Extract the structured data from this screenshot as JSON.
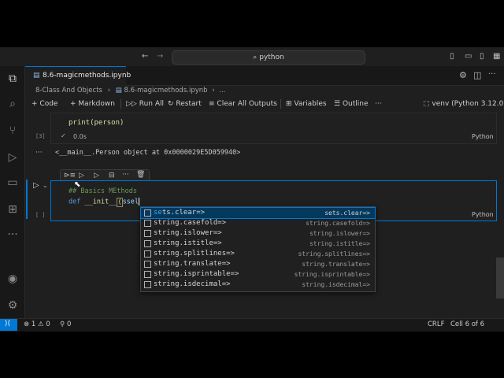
{
  "titlebar": {
    "search_text": "python",
    "nav_back": "←",
    "nav_forward": "→"
  },
  "tab": {
    "label": "8.6-magicmethods.ipynb"
  },
  "breadcrumb": {
    "folder": "8-Class And Objects",
    "file": "8.6-magicmethods.ipynb",
    "more": "..."
  },
  "toolbar": {
    "code": "Code",
    "markdown": "Markdown",
    "run_all": "Run All",
    "restart": "Restart",
    "clear_all": "Clear All Outputs",
    "variables": "Variables",
    "outline": "Outline",
    "more": "···",
    "kernel": "venv (Python 3.12.0)"
  },
  "cell1": {
    "code": "print(person)",
    "exec_count": "[3]",
    "time": "0.0s",
    "lang": "Python",
    "output": "<__main__.Person object at 0x0000029E5D059940>"
  },
  "cell2": {
    "exec_count": "[ ]",
    "comment": "## Basics MEthods",
    "kw": "def",
    "fn": "__init__",
    "paren": "(",
    "typed": "ssel",
    "lang": "Python"
  },
  "suggestions": [
    {
      "match": "se",
      "rest": "ts.clear=>",
      "detail": "sets.clear=>"
    },
    {
      "match": "",
      "rest": "string.casefold=>",
      "detail": "string.casefold=>"
    },
    {
      "match": "",
      "rest": "string.islower=>",
      "detail": "string.islower=>"
    },
    {
      "match": "",
      "rest": "string.istitle=>",
      "detail": "string.istitle=>"
    },
    {
      "match": "",
      "rest": "string.splitlines=>",
      "detail": "string.splitlines=>"
    },
    {
      "match": "",
      "rest": "string.translate=>",
      "detail": "string.translate=>"
    },
    {
      "match": "",
      "rest": "string.isprintable=>",
      "detail": "string.isprintable=>"
    },
    {
      "match": "",
      "rest": "string.isdecimal=>",
      "detail": "string.isdecimal=>"
    }
  ],
  "status": {
    "errors": "1",
    "warnings": "0",
    "ports": "0",
    "eol": "CRLF",
    "cell": "Cell 6 of 6"
  },
  "colors": {
    "accent": "#0078d4",
    "keyword": "#569cd6",
    "function": "#dcdcaa",
    "comment": "#6a9955",
    "match": "#2aaaff"
  }
}
